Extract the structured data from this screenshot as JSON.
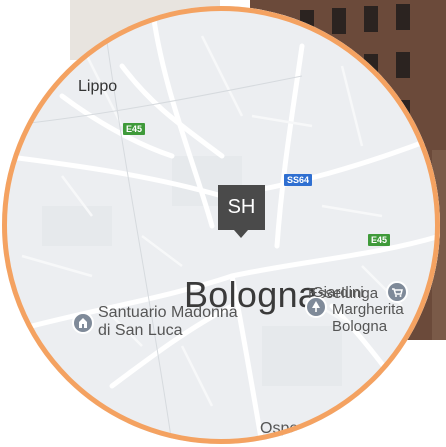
{
  "map": {
    "city_label": "Bologna",
    "labels": {
      "lippo": "Lippo",
      "esselunga": "Esselunga",
      "giardini": "Giardini",
      "margherita": "Margherita",
      "giardini_bologna": "Bologna",
      "santuario_line1": "Santuario Madonna",
      "santuario_line2": "di San Luca",
      "ospedale_partial": "Ospe"
    },
    "road_shields": {
      "e45_west": "E45",
      "ss64": "SS64",
      "e45_east": "E45"
    },
    "marker_text": "SH"
  },
  "colors": {
    "ring": "#f4a261",
    "map_background": "#eef0f2",
    "marker": "#4a4a4a",
    "shield_green": "#3f9a3a",
    "shield_blue": "#2f6fd1",
    "poi": "#7f8a99"
  },
  "icons": {
    "esselunga": "shopping-cart-icon",
    "giardini": "park-icon",
    "santuario": "church-icon"
  }
}
